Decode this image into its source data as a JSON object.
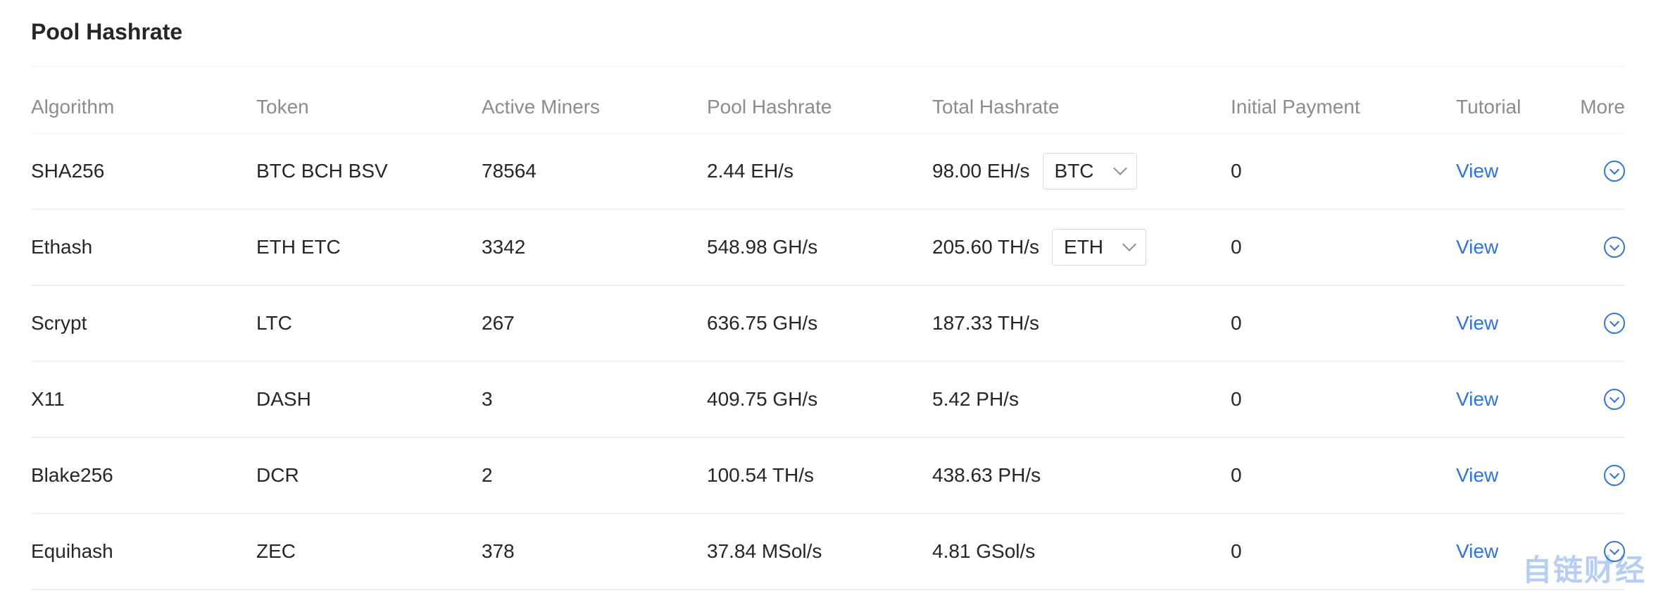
{
  "title": "Pool Hashrate",
  "columns": {
    "algorithm": "Algorithm",
    "token": "Token",
    "active_miners": "Active Miners",
    "pool_hashrate": "Pool Hashrate",
    "total_hashrate": "Total Hashrate",
    "initial_payment": "Initial Payment",
    "tutorial": "Tutorial",
    "more": "More"
  },
  "rows": [
    {
      "algorithm": "SHA256",
      "token": "BTC BCH BSV",
      "active_miners": "78564",
      "pool_hashrate": "2.44 EH/s",
      "total_hashrate": "98.00 EH/s",
      "coin_select": "BTC",
      "initial_payment": "0",
      "tutorial": "View"
    },
    {
      "algorithm": "Ethash",
      "token": "ETH ETC",
      "active_miners": "3342",
      "pool_hashrate": "548.98 GH/s",
      "total_hashrate": "205.60 TH/s",
      "coin_select": "ETH",
      "initial_payment": "0",
      "tutorial": "View"
    },
    {
      "algorithm": "Scrypt",
      "token": "LTC",
      "active_miners": "267",
      "pool_hashrate": "636.75 GH/s",
      "total_hashrate": "187.33 TH/s",
      "initial_payment": "0",
      "tutorial": "View"
    },
    {
      "algorithm": "X11",
      "token": "DASH",
      "active_miners": "3",
      "pool_hashrate": "409.75 GH/s",
      "total_hashrate": "5.42 PH/s",
      "initial_payment": "0",
      "tutorial": "View"
    },
    {
      "algorithm": "Blake256",
      "token": "DCR",
      "active_miners": "2",
      "pool_hashrate": "100.54 TH/s",
      "total_hashrate": "438.63 PH/s",
      "initial_payment": "0",
      "tutorial": "View"
    },
    {
      "algorithm": "Equihash",
      "token": "ZEC",
      "active_miners": "378",
      "pool_hashrate": "37.84 MSol/s",
      "total_hashrate": "4.81 GSol/s",
      "initial_payment": "0",
      "tutorial": "View"
    }
  ],
  "icons": {
    "more": "chevron-down-circle-icon",
    "select": "chevron-down-icon"
  },
  "colors": {
    "link": "#2f73e0",
    "text": "#262626",
    "header_text": "#8c8c8c",
    "divider": "#efefef"
  },
  "watermark": "自链财经"
}
